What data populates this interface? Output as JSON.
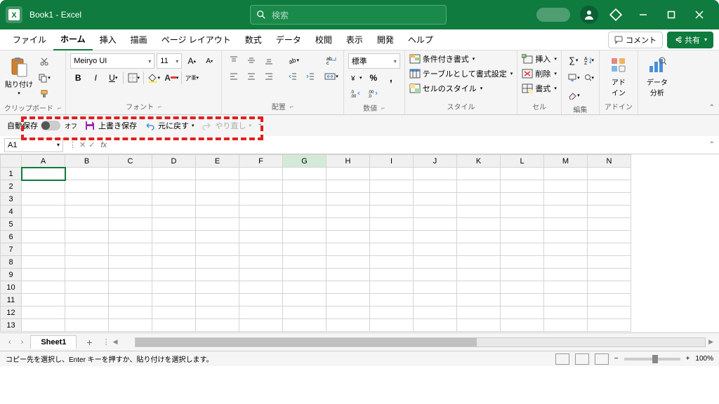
{
  "titlebar": {
    "title": "Book1  -  Excel",
    "search_placeholder": "検索"
  },
  "tabs": {
    "items": [
      "ファイル",
      "ホーム",
      "挿入",
      "描画",
      "ページ レイアウト",
      "数式",
      "データ",
      "校閲",
      "表示",
      "開発",
      "ヘルプ"
    ],
    "active": "ホーム",
    "comment": "コメント",
    "share": "共有"
  },
  "ribbon": {
    "clipboard": {
      "label": "クリップボード",
      "paste": "貼り付け"
    },
    "font": {
      "label": "フォント",
      "name": "Meiryo UI",
      "size": "11"
    },
    "alignment": {
      "label": "配置"
    },
    "number": {
      "label": "数値",
      "format": "標準"
    },
    "styles": {
      "label": "スタイル",
      "cond": "条件付き書式",
      "table": "テーブルとして書式設定",
      "cell": "セルのスタイル"
    },
    "cells": {
      "label": "セル",
      "insert": "挿入",
      "delete": "削除",
      "format": "書式"
    },
    "editing": {
      "label": "編集"
    },
    "addins": {
      "label": "アドイン",
      "btn": "アド\nイン"
    },
    "analysis": {
      "btn": "データ\n分析"
    }
  },
  "qat": {
    "autosave_label": "自動保存",
    "autosave_state": "オフ",
    "save": "上書き保存",
    "undo": "元に戻す",
    "redo": "やり直し"
  },
  "formula_bar": {
    "name_box": "A1"
  },
  "grid": {
    "columns": [
      "A",
      "B",
      "C",
      "D",
      "E",
      "F",
      "G",
      "H",
      "I",
      "J",
      "K",
      "L",
      "M",
      "N"
    ],
    "rows": [
      1,
      2,
      3,
      4,
      5,
      6,
      7,
      8,
      9,
      10,
      11,
      12,
      13
    ],
    "selected": "A1",
    "highlight_col": "G"
  },
  "sheet_tabs": {
    "active": "Sheet1"
  },
  "status_bar": {
    "message": "コピー先を選択し、Enter キーを押すか、貼り付けを選択します。",
    "zoom": "100%"
  }
}
